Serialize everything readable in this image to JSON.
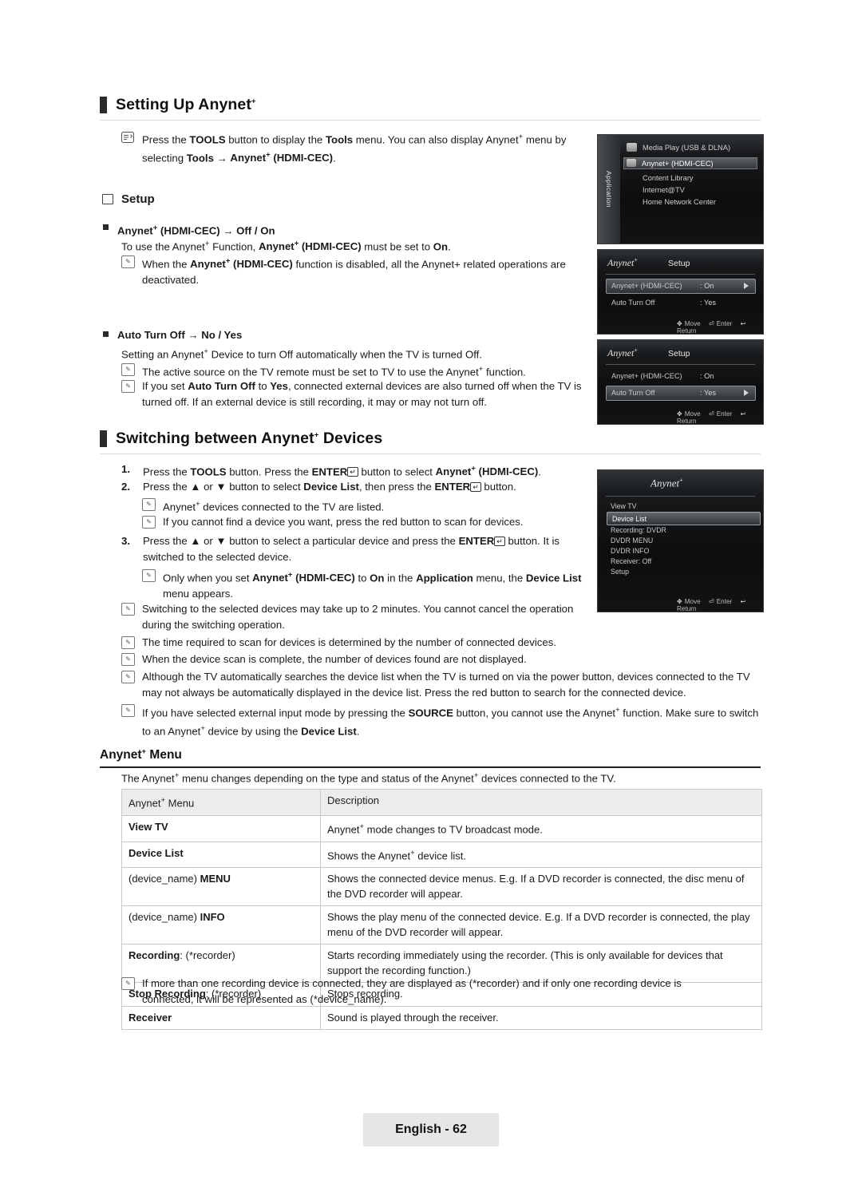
{
  "sections": {
    "setting_up": {
      "heading": "Setting Up Anynet+",
      "tools_note": "Press the TOOLS button to display the Tools menu. You can also display Anynet+ menu by selecting Tools → Anynet+ (HDMI-CEC).",
      "setup_label": "Setup",
      "hdmi_cec_label": "Anynet+ (HDMI-CEC) → Off / On",
      "hdmi_cec_text": "To use the Anynet+ Function, Anynet+ (HDMI-CEC) must be set to On.",
      "hdmi_cec_note": "When the Anynet+ (HDMI-CEC) function is disabled, all the Anynet+ related operations are deactivated.",
      "auto_turn_off_label": "Auto Turn Off → No / Yes",
      "auto_turn_off_text": "Setting an Anynet+ Device to turn Off automatically when the TV is turned Off.",
      "auto_note_1": "The active source on the TV remote must be set to TV to use the Anynet+ function.",
      "auto_note_2": "If you set Auto Turn Off to Yes, connected external devices are also turned off when the TV is turned off. If an external device is still recording, it may or may not turn off."
    },
    "switching": {
      "heading": "Switching between Anynet+ Devices",
      "step1": "Press the TOOLS button. Press the ENTER button to select Anynet+ (HDMI-CEC).",
      "step2": "Press the ▲ or ▼ button to select Device List, then press the ENTER button.",
      "step2_note1": "Anynet+ devices connected to the TV are listed.",
      "step2_note2": "If you cannot find a device you want, press the red button to scan for devices.",
      "step3": "Press the ▲ or ▼ button to select a particular device and press the ENTER button. It is switched to the selected device.",
      "step3_note": "Only when you set Anynet+ (HDMI-CEC) to On in the Application menu, the Device List menu appears.",
      "notes": [
        "Switching to the selected devices may take up to 2 minutes. You cannot cancel the operation during the switching operation.",
        "The time required to scan for devices is determined by the number of connected devices.",
        "When the device scan is complete, the number of devices found are not displayed.",
        "Although the TV automatically searches the device list when the TV is turned on via the power button, devices connected to the TV may not always be automatically displayed in the device list. Press the red button to search for the connected device.",
        "If you have selected external input mode by pressing the SOURCE button, you cannot use the Anynet+ function. Make sure to switch to an Anynet+ device by using the Device List."
      ]
    },
    "anynet_menu": {
      "heading": "Anynet+ Menu",
      "intro": "The Anynet+ menu changes depending on the type and status of the Anynet+ devices connected to the TV.",
      "table": {
        "headers": [
          "Anynet+ Menu",
          "Description"
        ],
        "rows": [
          [
            "View TV",
            "Anynet+ mode changes to TV broadcast mode."
          ],
          [
            "Device List",
            "Shows the Anynet+ device list."
          ],
          [
            "(device_name) MENU",
            "Shows the connected device menus. E.g. If a DVD recorder is connected, the disc menu of the DVD recorder will appear."
          ],
          [
            "(device_name) INFO",
            "Shows the play menu of the connected device. E.g. If a DVD recorder is connected, the play menu of the DVD recorder will appear."
          ],
          [
            "Recording: (*recorder)",
            "Starts recording immediately using the recorder. (This is only available for devices that support the recording function.)"
          ],
          [
            "Stop Recording: (*recorder)",
            "Stops recording."
          ],
          [
            "Receiver",
            "Sound is played through the receiver."
          ]
        ]
      },
      "footnote": "If more than one recording device is connected, they are displayed as (*recorder) and if only one recording device is connected, it will be represented as (*device_name)."
    }
  },
  "osd": {
    "application": {
      "tab_label": "Application",
      "items": [
        "Media Play (USB & DLNA)",
        "Anynet+ (HDMI-CEC)",
        "Content Library",
        "Internet@TV",
        "Home Network Center"
      ],
      "selected_index": 1
    },
    "setup_screen_1": {
      "logo": "Anynet",
      "logo_sup": "+",
      "title": "Setup",
      "rows": [
        {
          "label": "Anynet+ (HDMI-CEC)",
          "value": ": On"
        },
        {
          "label": "Auto Turn Off",
          "value": ": Yes"
        }
      ],
      "selected_index": 0,
      "footer": [
        "Move",
        "Enter",
        "Return"
      ]
    },
    "setup_screen_2": {
      "logo": "Anynet",
      "logo_sup": "+",
      "title": "Setup",
      "rows": [
        {
          "label": "Anynet+ (HDMI-CEC)",
          "value": ": On"
        },
        {
          "label": "Auto Turn Off",
          "value": ": Yes"
        }
      ],
      "selected_index": 1,
      "footer": [
        "Move",
        "Enter",
        "Return"
      ]
    },
    "device_list_screen": {
      "logo": "Anynet",
      "logo_sup": "+",
      "items": [
        "View TV",
        "Device List",
        "Recording: DVDR",
        "DVDR MENU",
        "DVDR INFO",
        "Receiver: Off",
        "Setup"
      ],
      "selected_index": 1,
      "footer": [
        "Move",
        "Enter",
        "Return"
      ]
    }
  },
  "footer": {
    "page_label": "English - 62"
  }
}
